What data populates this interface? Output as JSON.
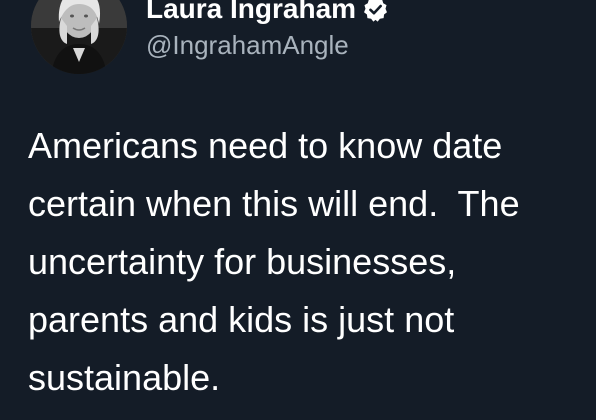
{
  "author": {
    "display_name": "Laura Ingraham",
    "handle": "@IngrahamAngle",
    "verified_icon": "verified-badge-icon",
    "avatar_icon": "profile-photo"
  },
  "tweet": {
    "lines": [
      "Americans need to know date",
      "certain when this will end.  The",
      "uncertainty for businesses,",
      "parents and kids is just not",
      "sustainable."
    ]
  },
  "colors": {
    "background": "#141c27",
    "text": "#ffffff",
    "handle": "#a9b3bd"
  }
}
